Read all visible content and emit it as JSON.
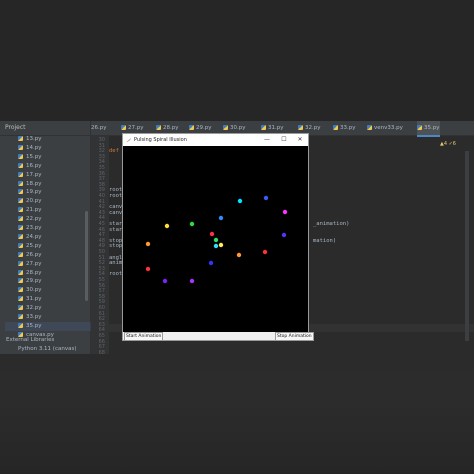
{
  "project_panel": {
    "header": "Project",
    "files": [
      "13.py",
      "14.py",
      "15.py",
      "16.py",
      "17.py",
      "18.py",
      "19.py",
      "20.py",
      "21.py",
      "22.py",
      "23.py",
      "24.py",
      "25.py",
      "26.py",
      "27.py",
      "28.py",
      "29.py",
      "30.py",
      "31.py",
      "32.py",
      "33.py",
      "35.py",
      "canvas.py"
    ],
    "selected": "35.py",
    "external_libraries": "External Libraries",
    "python_sdk": "Python 3.11 (canvas)"
  },
  "tabs": [
    {
      "label": "26.py"
    },
    {
      "label": "27.py"
    },
    {
      "label": "28.py"
    },
    {
      "label": "29.py"
    },
    {
      "label": "30.py"
    },
    {
      "label": "31.py"
    },
    {
      "label": "32.py"
    },
    {
      "label": "33.py"
    },
    {
      "label": "venv33.py"
    },
    {
      "label": "35.py",
      "active": true
    }
  ],
  "warnings": "▲4 ✓6",
  "editor": {
    "line_numbers": [
      "30",
      "31",
      "32",
      "33",
      "34",
      "35",
      "36",
      "37",
      "38",
      "39",
      "40",
      "41",
      "42",
      "43",
      "44",
      "45",
      "46",
      "47",
      "48",
      "49",
      "50",
      "51",
      "52",
      "53",
      "54",
      "55",
      "56",
      "57",
      "58",
      "59",
      "60",
      "61",
      "62",
      "63",
      "64",
      "65",
      "66",
      "67",
      "68"
    ],
    "visible_code": [
      {
        "text": "def",
        "kind": "kw",
        "line": 32
      },
      {
        "text": "root",
        "kind": "plain",
        "line": 39
      },
      {
        "text": "root",
        "kind": "plain",
        "line": 40
      },
      {
        "text": "canva",
        "kind": "plain",
        "line": 42
      },
      {
        "text": "canva",
        "kind": "plain",
        "line": 43
      },
      {
        "text": "start",
        "kind": "plain",
        "line": 45
      },
      {
        "text": "start",
        "kind": "plain",
        "line": 46
      },
      {
        "text": "_animation)",
        "kind": "plain",
        "line": 45
      },
      {
        "text": "stop_",
        "kind": "plain",
        "line": 48
      },
      {
        "text": "stop_",
        "kind": "plain",
        "line": 49
      },
      {
        "text": "mation)",
        "kind": "plain",
        "line": 48
      },
      {
        "text": "angle",
        "kind": "plain",
        "line": 51
      },
      {
        "text": "anima",
        "kind": "plain",
        "line": 52
      },
      {
        "text": "root.",
        "kind": "plain",
        "line": 54
      }
    ]
  },
  "tk_window": {
    "title": "Pulsing Spiral Illusion",
    "minimize": "—",
    "maximize": "☐",
    "close": "✕",
    "start_button": "Start Animation",
    "stop_button": "Stop Animation",
    "dots": [
      {
        "color": "#3b5bff"
      },
      {
        "color": "#00e5ff"
      },
      {
        "color": "#ff33ff"
      },
      {
        "color": "#5533ff"
      },
      {
        "color": "#ff3333"
      },
      {
        "color": "#ff9933"
      },
      {
        "color": "#3333ff"
      },
      {
        "color": "#aa33ff"
      },
      {
        "color": "#7a22ff"
      },
      {
        "color": "#ff3333"
      },
      {
        "color": "#ff9933"
      },
      {
        "color": "#ffdd33"
      },
      {
        "color": "#33dd33"
      },
      {
        "color": "#3388ff"
      },
      {
        "color": "#ff3344"
      },
      {
        "color": "#33dd66"
      },
      {
        "color": "#33ddff"
      },
      {
        "color": "#ffee55"
      }
    ]
  }
}
